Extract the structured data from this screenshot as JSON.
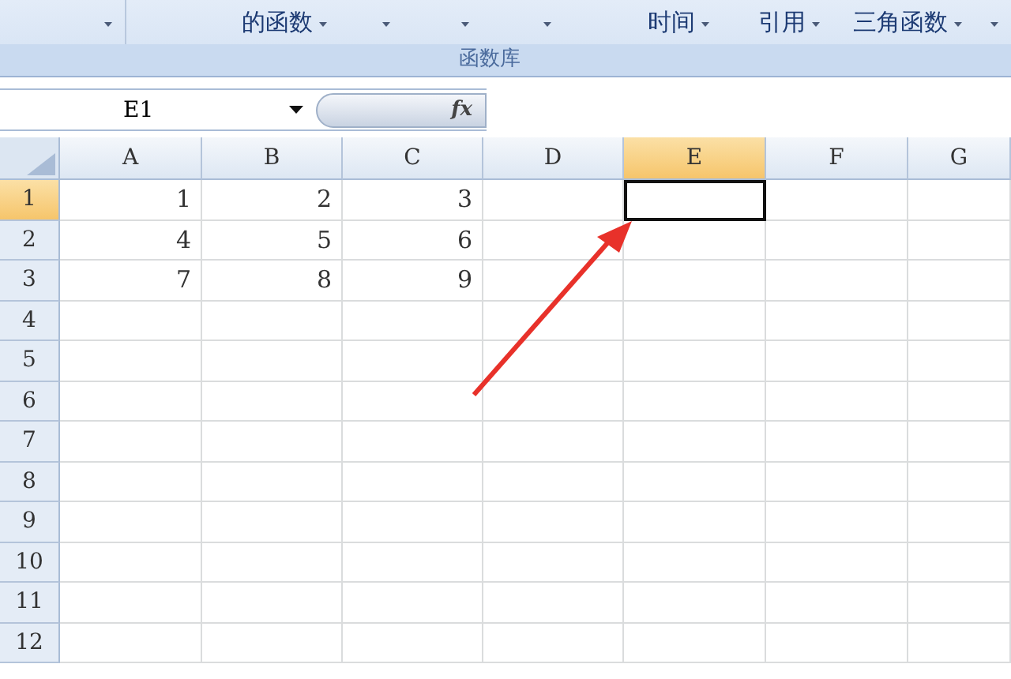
{
  "ribbon": {
    "items": [
      {
        "kind": "arrow"
      },
      {
        "kind": "labeled",
        "label": "的函数"
      },
      {
        "kind": "arrow"
      },
      {
        "kind": "arrow"
      },
      {
        "kind": "arrow"
      },
      {
        "kind": "labeled",
        "label": "时间"
      },
      {
        "kind": "labeled",
        "label": "引用"
      },
      {
        "kind": "labeled",
        "label": "三角函数"
      },
      {
        "kind": "arrow"
      }
    ],
    "group_label": "函数库"
  },
  "formula_bar": {
    "name_box": "E1",
    "fx": "fx"
  },
  "sheet": {
    "columns": [
      {
        "label": "A",
        "selected": false
      },
      {
        "label": "B",
        "selected": false
      },
      {
        "label": "C",
        "selected": false
      },
      {
        "label": "D",
        "selected": false
      },
      {
        "label": "E",
        "selected": true
      },
      {
        "label": "F",
        "selected": false
      },
      {
        "label": "G",
        "selected": false
      }
    ],
    "rows": [
      {
        "label": "1",
        "selected": true,
        "cells": [
          "1",
          "2",
          "3"
        ]
      },
      {
        "label": "2",
        "selected": false,
        "cells": [
          "4",
          "5",
          "6"
        ]
      },
      {
        "label": "3",
        "selected": false,
        "cells": [
          "7",
          "8",
          "9"
        ]
      },
      {
        "label": "4",
        "selected": false,
        "cells": []
      },
      {
        "label": "5",
        "selected": false,
        "cells": []
      },
      {
        "label": "6",
        "selected": false,
        "cells": []
      },
      {
        "label": "7",
        "selected": false,
        "cells": []
      },
      {
        "label": "8",
        "selected": false,
        "cells": []
      },
      {
        "label": "9",
        "selected": false,
        "cells": []
      },
      {
        "label": "10",
        "selected": false,
        "cells": []
      },
      {
        "label": "11",
        "selected": false,
        "cells": []
      },
      {
        "label": "12",
        "selected": false,
        "cells": []
      }
    ]
  }
}
